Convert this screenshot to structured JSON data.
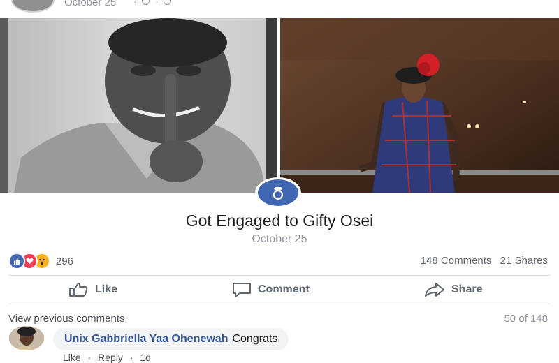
{
  "post": {
    "date": "October 25"
  },
  "life_event": {
    "title": "Got Engaged to Gifty Osei",
    "date": "October 25",
    "icon": "ring-icon"
  },
  "reactions": {
    "types": [
      "like-icon",
      "love-icon",
      "wow-icon"
    ],
    "count": "296"
  },
  "stats": {
    "comments": "148 Comments",
    "shares": "21 Shares"
  },
  "actions": {
    "like": "Like",
    "comment": "Comment",
    "share": "Share"
  },
  "comments": {
    "view_previous": "View previous comments",
    "count": "50 of 148",
    "items": [
      {
        "author": "Unix Gabbriella Yaa Ohenewah",
        "text": "Congrats",
        "meta_like": "Like",
        "meta_reply": "Reply",
        "meta_time": "1d"
      }
    ]
  },
  "colors": {
    "brand": "#4267b2",
    "link": "#385898",
    "love": "#f33e58",
    "wow": "#f7b125"
  }
}
